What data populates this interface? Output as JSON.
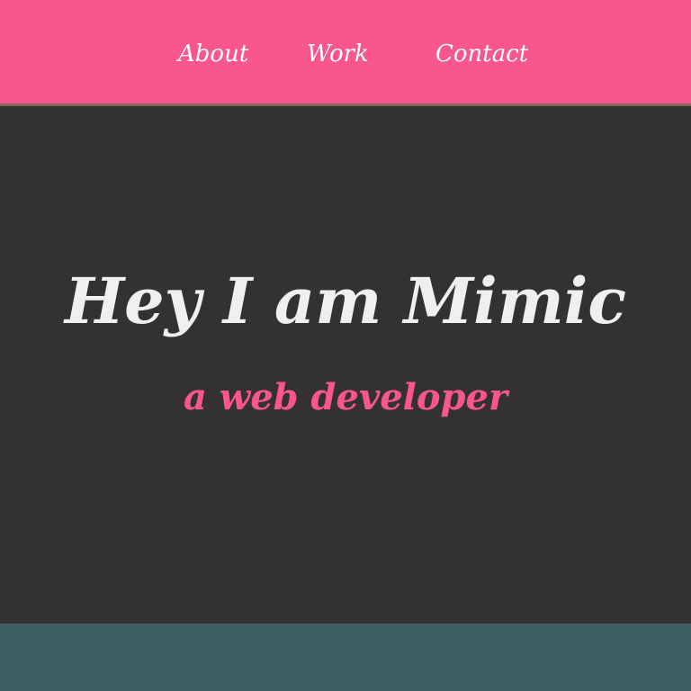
{
  "nav": {
    "items": [
      {
        "label": "About"
      },
      {
        "label": "Work"
      },
      {
        "label": "Contact"
      }
    ]
  },
  "hero": {
    "title": "Hey I am Mimic",
    "subtitle": "a web developer"
  },
  "colors": {
    "header_background": "#f9568e",
    "hero_background": "#343131",
    "footer_background": "#3c6064",
    "title_text": "#efefef",
    "subtitle_text": "#f9568e",
    "nav_text": "#ffffff"
  }
}
